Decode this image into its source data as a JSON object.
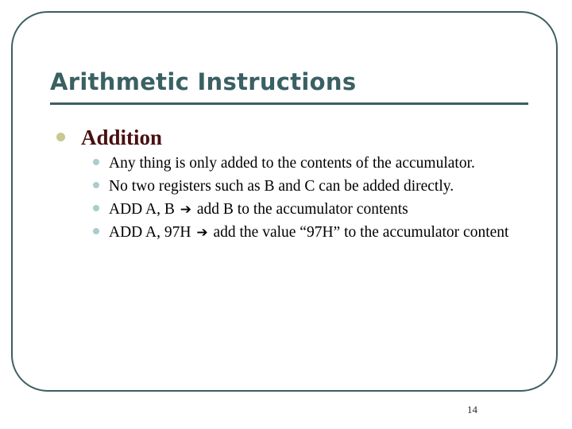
{
  "slide": {
    "title": "Arithmetic Instructions",
    "page_number": "14",
    "colors": {
      "frame": "#3d5e61",
      "title": "#3a6063",
      "rule": "#3d5e61",
      "level1_text": "#480f11",
      "level1_bullet": "#c9c894",
      "level2_bullet": "#a9cdce",
      "level2_text": "#000000",
      "background": "#ffffff"
    },
    "outline": [
      {
        "level": 1,
        "text": "Addition",
        "bullet": "filled-circle-khaki",
        "children": [
          {
            "level": 2,
            "bullet": "filled-circle-lightblue",
            "parts": [
              {
                "type": "text",
                "value": "Any thing is only added to the contents of the accumulator."
              }
            ]
          },
          {
            "level": 2,
            "bullet": "filled-circle-lightblue",
            "parts": [
              {
                "type": "text",
                "value": "No two registers such as B and C can be added directly."
              }
            ]
          },
          {
            "level": 2,
            "bullet": "filled-circle-lightblue",
            "parts": [
              {
                "type": "text",
                "value": "ADD A, B "
              },
              {
                "type": "arrow",
                "value": "➔"
              },
              {
                "type": "text",
                "value": " add  B to the accumulator contents"
              }
            ]
          },
          {
            "level": 2,
            "bullet": "filled-circle-lightblue",
            "parts": [
              {
                "type": "text",
                "value": "ADD A, 97H "
              },
              {
                "type": "arrow",
                "value": "➔"
              },
              {
                "type": "text",
                "value": " add the value “97H”  to the accumulator content"
              }
            ]
          }
        ]
      }
    ]
  }
}
